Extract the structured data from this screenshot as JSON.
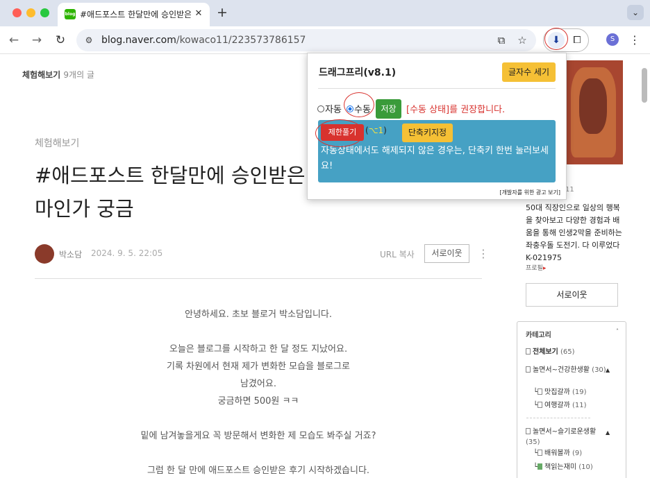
{
  "colors": {
    "accent_red": "#d8322e",
    "yellow_button": "#f5c035",
    "green_button": "#3a9b3a",
    "info_blue": "#46a1c4"
  },
  "browser": {
    "tab_title": "#애드포스트 한달만에 승인받은 후기",
    "tab_favicon_text": "blog",
    "url_host": "blog.naver.com",
    "url_path": "/kowaco11/223573786157",
    "profile_initial": "S"
  },
  "extension_popup": {
    "title": "드래그프리(v8.1)",
    "count_button": "글자수 세기",
    "radio_auto": "자동",
    "radio_manual": "수동",
    "save_button": "저장",
    "recommend_note": "[수동 상태]를 권장합니다.",
    "release_button": "제한풀기",
    "shortcut_open": "(",
    "shortcut_key": "⌥1",
    "shortcut_close": ")",
    "shortcut_set_button": "단축키지정",
    "info_text": "자동상태에서도 해제되지 않은 경우는, 단축키 한번 눌러보세요!",
    "ad_note": "[개발자를 위한 광고 보기]"
  },
  "blog": {
    "category_name": "체험해보기",
    "category_count": "9개의 글",
    "post_category": "체험해보기",
    "post_title": "#애드포스트 한달만에 승인받은 마인가 궁금",
    "author": "박소담",
    "date": "2024. 9. 5. 22:05",
    "url_copy": "URL 복사",
    "neighbor_button": "서로이웃",
    "body_lines": [
      "안녕하세요. 초보 블로거 박소담입니다.",
      "오늘은 블로그를 시작하고 한 달 정도 지났어요.",
      "기록 차원에서 현재 제가 변화한 모습을 블로그로",
      "남겼어요.",
      "궁금하면 500원 ㅋㅋ",
      "밑에 남겨놓을게요 꼭 방문해서 변화한 제 모습도 봐주실 거죠?",
      "그럼 한 달 만에 애드포스트 승인받은 후기 시작하겠습니다."
    ]
  },
  "sidebar": {
    "nickname_suffix": "11",
    "intro": "50대 직장인으로 일상의 행복을 찾아보고 다양한 경험과 배움을 통해 인생2막을 준비하는 좌충우돌 도전기.  다 이루었다 K-021975",
    "profile_link": "프로필",
    "neighbor_button": "서로이웃",
    "category_header": "카테고리",
    "categories": [
      {
        "label": "전체보기",
        "count": "(65)"
      },
      {
        "label": "놀면서~건강한생활",
        "count": "(30)"
      },
      {
        "label": "맛집갈까",
        "count": "(19)"
      },
      {
        "label": "여행갈까",
        "count": "(11)"
      },
      {
        "label": "놀면서~슬기로운생활",
        "count": "(35)"
      },
      {
        "label": "배워볼까",
        "count": "(9)"
      },
      {
        "label": "책읽는재미",
        "count": "(10)"
      }
    ]
  }
}
